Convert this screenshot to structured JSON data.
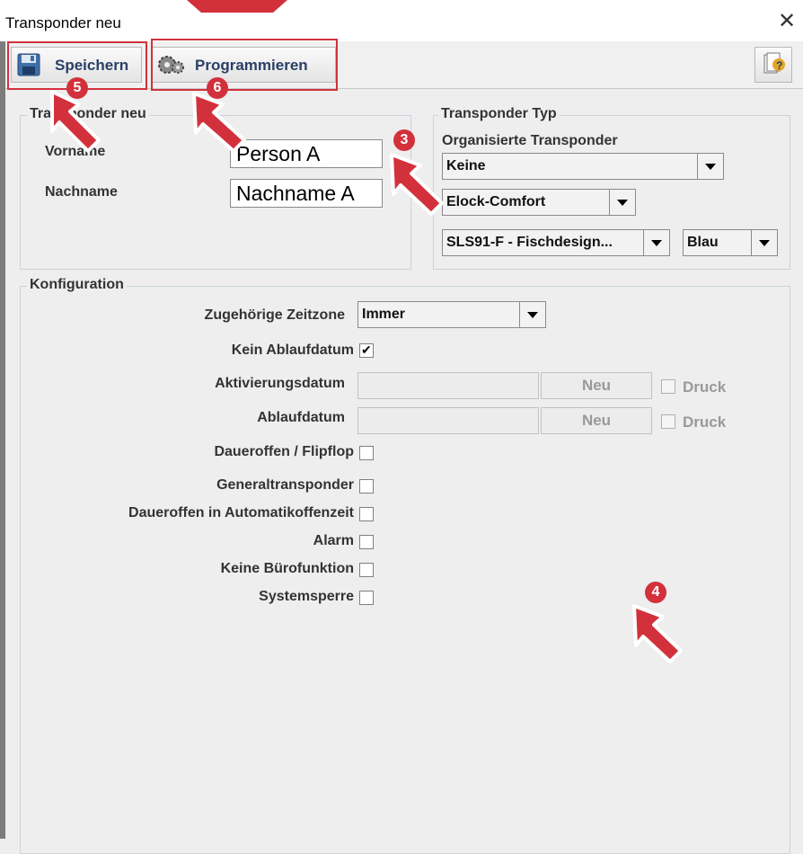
{
  "window": {
    "title": "Transponder neu",
    "close_glyph": "✕"
  },
  "toolbar": {
    "save_label": "Speichern",
    "program_label": "Programmieren",
    "save_icon": "floppy-disk-icon",
    "program_icon": "gears-icon",
    "help_icon": "help-icon"
  },
  "transponder_group": {
    "legend": "Transponder neu",
    "vorname_label": "Vorname",
    "vorname_value": "Person A",
    "nachname_label": "Nachname",
    "nachname_value": "Nachname A"
  },
  "type_group": {
    "legend": "Transponder Typ",
    "organized_label": "Organisierte Transponder",
    "organized_value": "Keine",
    "system_value": "Elock-Comfort",
    "model_value": "SLS91-F - Fischdesign...",
    "color_value": "Blau"
  },
  "config_group": {
    "legend": "Konfiguration",
    "zeitzone_label": "Zugehörige Zeitzone",
    "zeitzone_value": "Immer",
    "kein_ablauf_label": "Kein Ablaufdatum",
    "aktivierung_label": "Aktivierungsdatum",
    "ablauf_label": "Ablaufdatum",
    "neu_label": "Neu",
    "druck_label": "Druck",
    "options": [
      "Daueroffen / Flipflop",
      "Generaltransponder",
      "Daueroffen in Automatikoffenzeit",
      "Alarm",
      "Keine Bürofunktion",
      "Systemsperre"
    ]
  },
  "annotations": {
    "b3": "3",
    "b4": "4",
    "b5": "5",
    "b6": "6"
  },
  "colors": {
    "accent_red": "#d2313c",
    "label_blue": "#2a3f66"
  }
}
